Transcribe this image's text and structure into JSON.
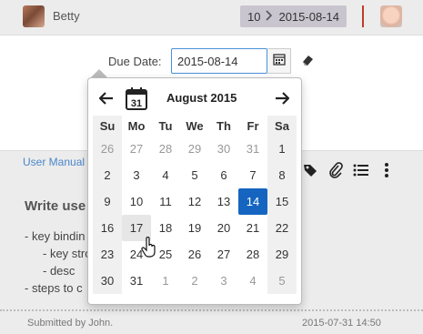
{
  "header": {
    "user_name": "Betty",
    "breadcrumb": {
      "number": "10",
      "date": "2015-08-14"
    }
  },
  "form": {
    "due_label": "Due Date:",
    "due_value": "2015-08-14"
  },
  "links": {
    "manual": "User Manual"
  },
  "content": {
    "title": "Write use",
    "items": [
      "- key bindin",
      "- key stro",
      "- desc",
      "- steps to c"
    ]
  },
  "footer": {
    "submitted": "Submitted by John.",
    "timestamp": "2015-07-31 14:50"
  },
  "datepicker": {
    "month_label": "August 2015",
    "today_icon_number": "31",
    "weekdays": [
      "Su",
      "Mo",
      "Tu",
      "We",
      "Th",
      "Fr",
      "Sa"
    ],
    "weeks": [
      [
        "26",
        "27",
        "28",
        "29",
        "30",
        "31",
        "1"
      ],
      [
        "2",
        "3",
        "4",
        "5",
        "6",
        "7",
        "8"
      ],
      [
        "9",
        "10",
        "11",
        "12",
        "13",
        "14",
        "15"
      ],
      [
        "16",
        "17",
        "18",
        "19",
        "20",
        "21",
        "22"
      ],
      [
        "23",
        "24",
        "25",
        "26",
        "27",
        "28",
        "29"
      ],
      [
        "30",
        "31",
        "1",
        "2",
        "3",
        "4",
        "5"
      ]
    ],
    "selected_day": "14",
    "hover_day": "17"
  },
  "icons": {
    "prev": "arrow-left-icon",
    "next": "arrow-right-icon",
    "calendar": "calendar-icon",
    "eraser": "eraser-icon",
    "tag": "tag-icon",
    "paperclip": "paperclip-icon",
    "list": "list-icon",
    "more": "more-vertical-icon"
  },
  "colors": {
    "accent": "#1565c0",
    "link": "#4a86c8",
    "breadcrumb_bg": "#c9c5cf"
  }
}
